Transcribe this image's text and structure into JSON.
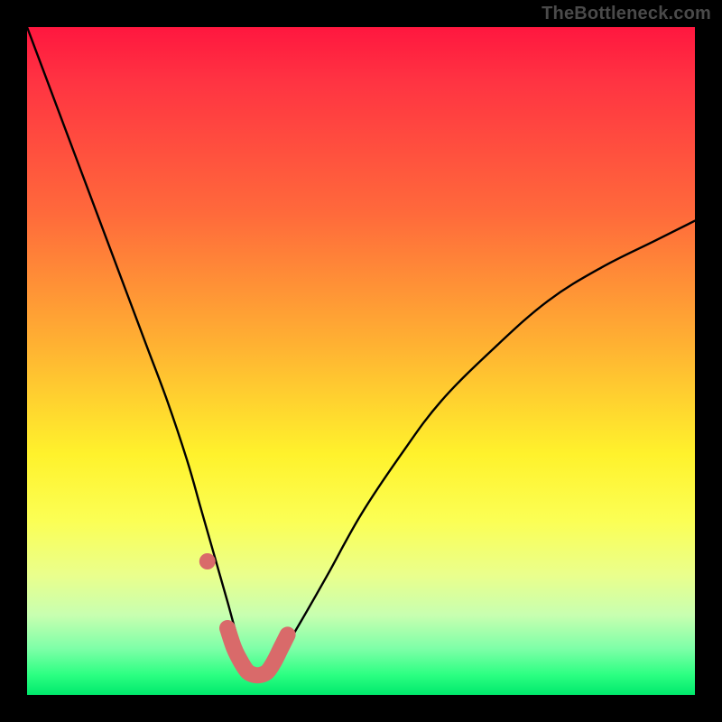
{
  "watermark": "TheBottleneck.com",
  "colors": {
    "frame": "#000000",
    "curve": "#000000",
    "marker": "#d96a6a",
    "gradient_stops": [
      {
        "pos": 0,
        "color": "#ff173f"
      },
      {
        "pos": 8,
        "color": "#ff3342"
      },
      {
        "pos": 28,
        "color": "#ff6a3b"
      },
      {
        "pos": 48,
        "color": "#ffb332"
      },
      {
        "pos": 64,
        "color": "#fff22c"
      },
      {
        "pos": 74,
        "color": "#fbff55"
      },
      {
        "pos": 82,
        "color": "#eaff8c"
      },
      {
        "pos": 88,
        "color": "#c8ffb0"
      },
      {
        "pos": 93,
        "color": "#7fffa8"
      },
      {
        "pos": 97,
        "color": "#2cff82"
      },
      {
        "pos": 100,
        "color": "#00e96c"
      }
    ]
  },
  "chart_data": {
    "type": "line",
    "title": "",
    "xlabel": "",
    "ylabel": "",
    "x_range": [
      0,
      100
    ],
    "y_range": [
      0,
      100
    ],
    "note": "V-shaped bottleneck curve; y is normalized bottleneck severity (0=none, 100=max). Minimum near x≈34.",
    "series": [
      {
        "name": "bottleneck-curve",
        "x": [
          0,
          3,
          6,
          9,
          12,
          15,
          18,
          21,
          24,
          26,
          28,
          30,
          32,
          34,
          36,
          38,
          41,
          45,
          50,
          56,
          62,
          70,
          78,
          86,
          94,
          100
        ],
        "y": [
          100,
          92,
          84,
          76,
          68,
          60,
          52,
          44,
          35,
          28,
          21,
          14,
          7,
          3,
          3,
          6,
          11,
          18,
          27,
          36,
          44,
          52,
          59,
          64,
          68,
          71
        ]
      }
    ],
    "markers": {
      "name": "highlighted-segment",
      "note": "Thick pink segment near the curve minimum plus one isolated dot slightly above on the left branch.",
      "points": [
        {
          "x": 27,
          "y": 20
        },
        {
          "x": 30,
          "y": 10
        },
        {
          "x": 31,
          "y": 7
        },
        {
          "x": 32,
          "y": 5
        },
        {
          "x": 33,
          "y": 3.5
        },
        {
          "x": 34,
          "y": 3
        },
        {
          "x": 35,
          "y": 3
        },
        {
          "x": 36,
          "y": 3.5
        },
        {
          "x": 37,
          "y": 5
        },
        {
          "x": 38,
          "y": 7
        },
        {
          "x": 39,
          "y": 9
        }
      ]
    }
  }
}
